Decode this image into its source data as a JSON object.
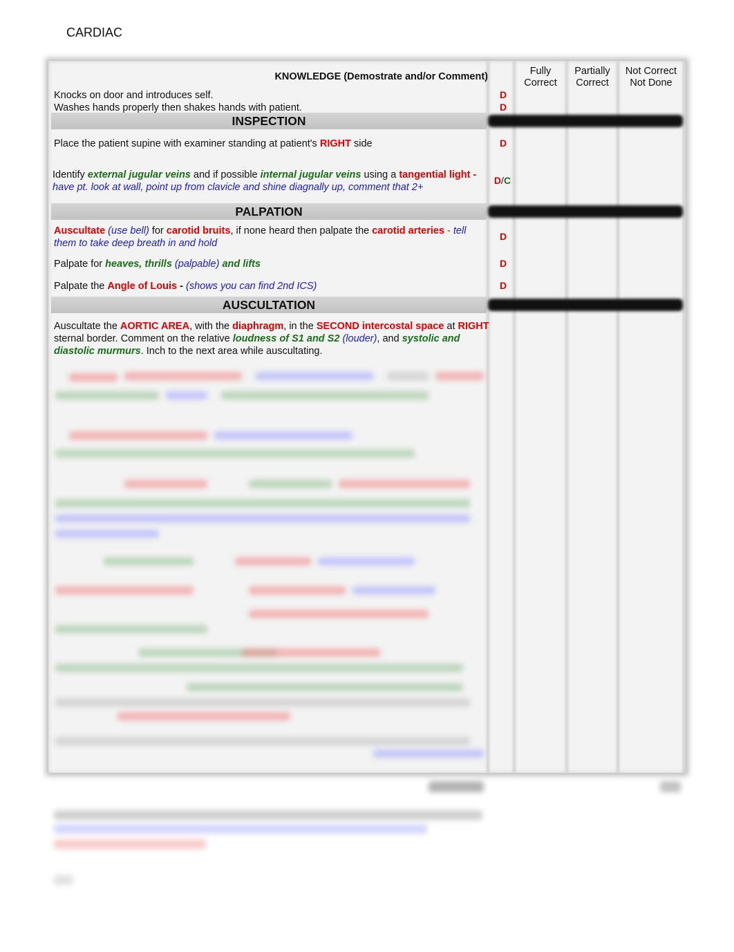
{
  "page": {
    "title": "CARDIAC"
  },
  "table": {
    "knowledge_header": "KNOWLEDGE (Demostrate and/or Comment)",
    "columns": [
      {
        "line1": "Fully",
        "line2": "Correct"
      },
      {
        "line1": "Partially",
        "line2": "Correct"
      },
      {
        "line1": "Not Correct",
        "line2": "Not Done"
      }
    ],
    "knowledge_items": [
      {
        "text": "Knocks on door and introduces self.",
        "code": "D"
      },
      {
        "text": "Washes hands properly then shakes hands with patient.",
        "code": "D"
      }
    ],
    "sections": {
      "inspection": "INSPECTION",
      "palpation": "PALPATION",
      "auscultation": "AUSCULTATION"
    },
    "inspection_items": [
      {
        "parts": [
          "Place the patient supine with examiner standing at patient's ",
          "RIGHT",
          " side"
        ],
        "code": "D"
      },
      {
        "parts": [
          "Identify ",
          "external jugular veins",
          " and if possible ",
          "internal jugular veins",
          " using a ",
          "tangential light",
          " - ",
          "have pt. look at wall, point up from clavicle and shine diagnally up, comment that 2+"
        ],
        "code_d": "D",
        "code_sep": "/",
        "code_c": "C"
      }
    ],
    "palpation_items": [
      {
        "parts": [
          "Auscultate",
          " ",
          "(use bell)",
          " for ",
          "carotid bruits",
          ", if none heard then palpate the ",
          "carotid arteries",
          " - ",
          "tell them to take deep breath in and hold"
        ],
        "code": "D"
      },
      {
        "parts": [
          "Palpate for ",
          "heaves, thrills",
          " ",
          "(palpable)",
          " ",
          "and lifts"
        ],
        "code": "D"
      },
      {
        "parts": [
          "Palpate the ",
          "Angle of Louis",
          " - ",
          "(shows you can find 2nd ICS)"
        ],
        "code": "D"
      }
    ],
    "auscultation_items": [
      {
        "parts": [
          "Auscultate the ",
          "AORTIC AREA",
          ", with the ",
          "diaphragm",
          ", in the ",
          "SECOND intercostal space",
          " at ",
          "RIGHT",
          " sternal border.  Comment on the relative ",
          "loudness of S1 and S2",
          " ",
          "(louder)",
          ", and ",
          "systolic and diastolic murmurs",
          ". Inch to the next area while auscultating."
        ]
      }
    ]
  },
  "blurred_region_note": "Remaining content is blurred and unreadable"
}
